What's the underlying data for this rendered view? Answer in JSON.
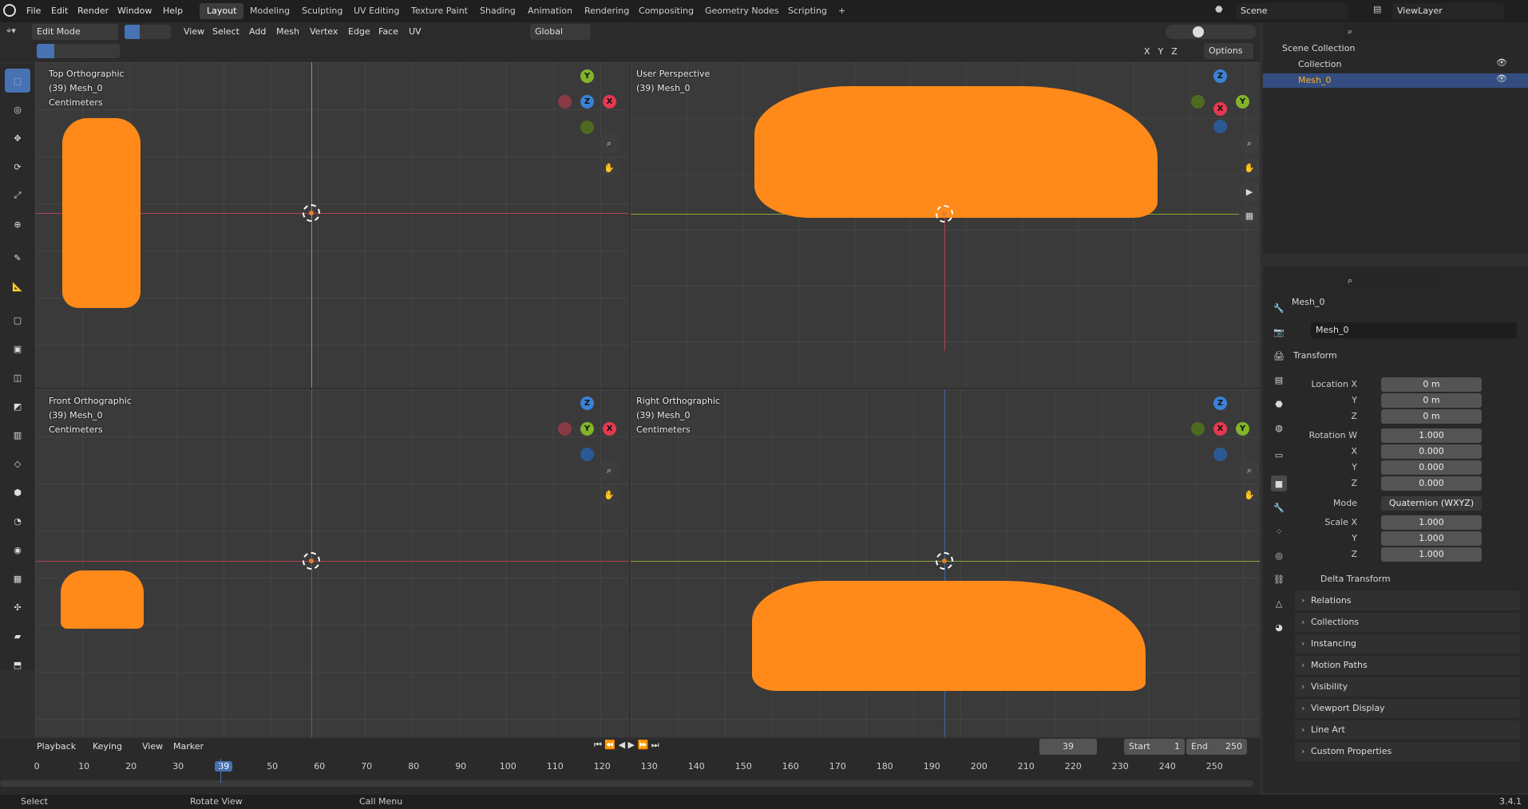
{
  "topbar": {
    "menus": [
      "File",
      "Edit",
      "Render",
      "Window",
      "Help"
    ],
    "workspaces": [
      "Layout",
      "Modeling",
      "Sculpting",
      "UV Editing",
      "Texture Paint",
      "Shading",
      "Animation",
      "Rendering",
      "Compositing",
      "Geometry Nodes",
      "Scripting"
    ],
    "active_workspace": "Layout",
    "scene": "Scene",
    "view_layer": "ViewLayer",
    "add_tab": "+"
  },
  "header3d": {
    "mode": "Edit Mode",
    "menus": [
      "View",
      "Select",
      "Add",
      "Mesh",
      "Vertex",
      "Edge",
      "Face",
      "UV"
    ],
    "transform": "Global",
    "axes": [
      "X",
      "Y",
      "Z"
    ],
    "options": "Options"
  },
  "viewports": [
    {
      "name": "Top Orthographic",
      "object": "(39) Mesh_0",
      "units": "Centimeters"
    },
    {
      "name": "User Perspective",
      "object": "(39) Mesh_0",
      "units": ""
    },
    {
      "name": "Front Orthographic",
      "object": "(39) Mesh_0",
      "units": "Centimeters"
    },
    {
      "name": "Right Orthographic",
      "object": "(39) Mesh_0",
      "units": "Centimeters"
    }
  ],
  "gizmo": {
    "x": "X",
    "y": "Y",
    "z": "Z"
  },
  "outliner": {
    "scene_collection": "Scene Collection",
    "collection": "Collection",
    "mesh": "Mesh_0"
  },
  "properties": {
    "object_name": "Mesh_0",
    "mesh_name": "Mesh_0",
    "transform": "Transform",
    "rows": [
      {
        "label": "Location X",
        "value": "0 m"
      },
      {
        "label": "Y",
        "value": "0 m"
      },
      {
        "label": "Z",
        "value": "0 m"
      },
      {
        "label": "Rotation W",
        "value": "1.000"
      },
      {
        "label": "X",
        "value": "0.000"
      },
      {
        "label": "Y",
        "value": "0.000"
      },
      {
        "label": "Z",
        "value": "0.000"
      },
      {
        "label": "Mode",
        "value": "Quaternion (WXYZ)"
      },
      {
        "label": "Scale X",
        "value": "1.000"
      },
      {
        "label": "Y",
        "value": "1.000"
      },
      {
        "label": "Z",
        "value": "1.000"
      }
    ],
    "delta": "Delta Transform",
    "panels": [
      "Relations",
      "Collections",
      "Instancing",
      "Motion Paths",
      "Visibility",
      "Viewport Display",
      "Line Art",
      "Custom Properties"
    ]
  },
  "timeline": {
    "menus": [
      "Playback",
      "Keying",
      "View",
      "Marker"
    ],
    "current": "39",
    "start_label": "Start",
    "start": "1",
    "end_label": "End",
    "end": "250",
    "ticks": [
      "0",
      "10",
      "20",
      "30",
      "39",
      "50",
      "60",
      "70",
      "80",
      "90",
      "100",
      "110",
      "120",
      "130",
      "140",
      "150",
      "160",
      "170",
      "180",
      "190",
      "200",
      "210",
      "220",
      "230",
      "240",
      "250"
    ]
  },
  "status": {
    "select": "Select",
    "rotate": "Rotate View",
    "call_menu": "Call Menu",
    "version": "3.4.1"
  },
  "colors": {
    "accent": "#4772b3",
    "mesh": "#ff8a1a",
    "x_axis": "#e5394f",
    "y_axis": "#82b32a",
    "z_axis": "#3a82d6"
  }
}
